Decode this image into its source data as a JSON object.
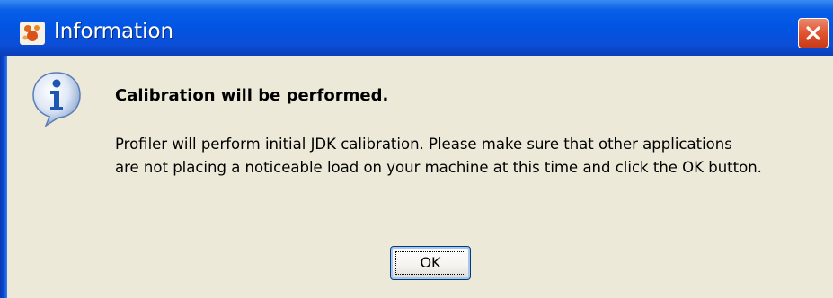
{
  "dialog": {
    "title": "Information",
    "heading": "Calibration will be performed.",
    "message_lines": [
      "Profiler will perform initial JDK calibration. Please make sure that other applications",
      "are not placing a noticeable load on your machine at this time and click the OK button."
    ],
    "ok_label": "OK",
    "title_icon": "app-icon",
    "info_icon": "information-icon",
    "close_icon": "close-icon"
  },
  "colors": {
    "titlebar": "#0055e5",
    "background": "#ece9d8",
    "close_button": "#e2532f"
  }
}
